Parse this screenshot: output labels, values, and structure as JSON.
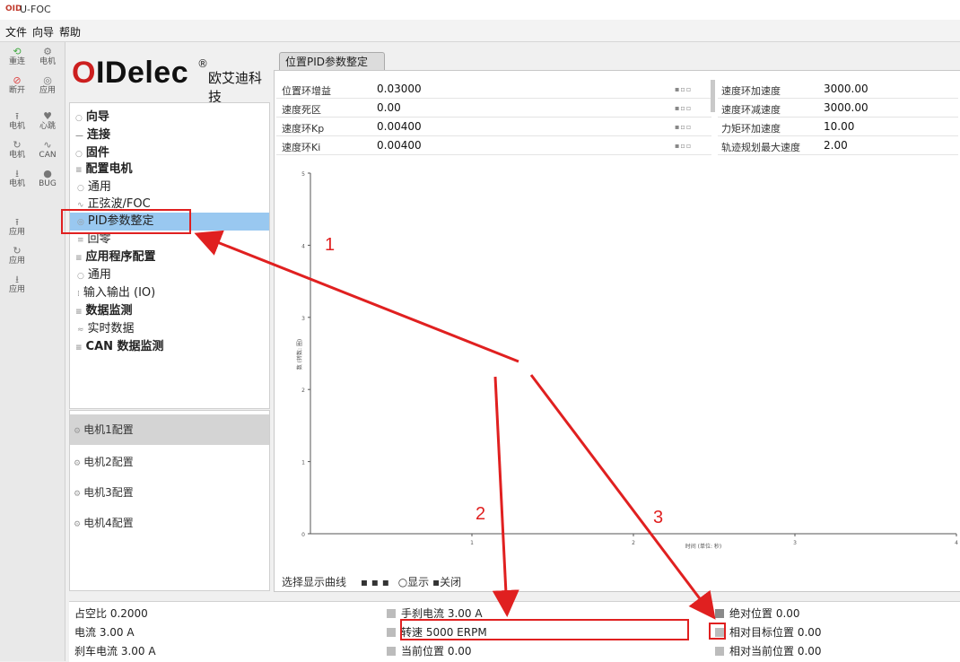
{
  "app": {
    "logo_text": "OID",
    "title": "U-FOC"
  },
  "menu": [
    "文件",
    "向导",
    "帮助"
  ],
  "toolbar": [
    [
      "重连",
      "电机"
    ],
    [
      "断开",
      "应用"
    ],
    [
      "电机",
      "心跳"
    ],
    [
      "电机",
      "CAN"
    ],
    [
      "电机",
      "BUG"
    ],
    [
      "应用",
      ""
    ],
    [
      "应用",
      ""
    ],
    [
      "应用",
      ""
    ]
  ],
  "brand": {
    "name_black": "OIDelec",
    "registered": "®",
    "chinese": "欧艾迪科技"
  },
  "nav": {
    "items": [
      {
        "label": "向导",
        "bold": true
      },
      {
        "label": "连接",
        "bold": true
      },
      {
        "label": "固件",
        "bold": true
      },
      {
        "label": "配置电机",
        "bold": true
      },
      {
        "label": "通用",
        "bold": false
      },
      {
        "label": "正弦波/FOC",
        "bold": false
      },
      {
        "label": "PID参数整定",
        "bold": false
      },
      {
        "label": "回零",
        "bold": false
      },
      {
        "label": "应用程序配置",
        "bold": true
      },
      {
        "label": "通用",
        "bold": false
      },
      {
        "label": "输入输出 (IO)",
        "bold": false
      },
      {
        "label": "数据监测",
        "bold": true
      },
      {
        "label": "实时数据",
        "bold": false
      },
      {
        "label": "CAN 数据监测",
        "bold": true
      }
    ],
    "selected_index": 6
  },
  "motors": [
    "电机1配置",
    "电机2配置",
    "电机3配置",
    "电机4配置"
  ],
  "tab": "位置PID参数整定",
  "params_left": [
    {
      "name": "位置环增益",
      "value": "0.03000"
    },
    {
      "name": "速度死区",
      "value": "0.00"
    },
    {
      "name": "速度环Kp",
      "value": "0.00400"
    },
    {
      "name": "速度环Ki",
      "value": "0.00400"
    }
  ],
  "params_right": [
    {
      "name": "速度环加速度",
      "value": "3000.00"
    },
    {
      "name": "速度环减速度",
      "value": "3000.00"
    },
    {
      "name": "力矩环加速度",
      "value": "10.00"
    },
    {
      "name": "轨迹规划最大速度",
      "value": "2.00"
    }
  ],
  "chart_data": {
    "type": "line",
    "y_ticks": [
      "5",
      "4",
      "3",
      "2",
      "1",
      "0"
    ],
    "x_ticks": [
      "1",
      "2",
      "3",
      "4"
    ],
    "xlabel": "时间 (单位: 秒)",
    "ylabel": "数 (转数: 圈)",
    "series": []
  },
  "legend_bar": {
    "label": "选择显示曲线",
    "options": "○显示 ▪关闭"
  },
  "status": {
    "col1": [
      "占空比 0.2000",
      "电流 3.00 A",
      "刹车电流 3.00 A"
    ],
    "col2": [
      "手刹电流 3.00 A",
      "转速 5000 ERPM",
      "当前位置 0.00"
    ],
    "col3": [
      "绝对位置 0.00",
      "相对目标位置 0.00",
      "相对当前位置 0.00"
    ]
  },
  "annotations": {
    "n1": "1",
    "n2": "2",
    "n3": "3",
    "color": "#e02020"
  }
}
